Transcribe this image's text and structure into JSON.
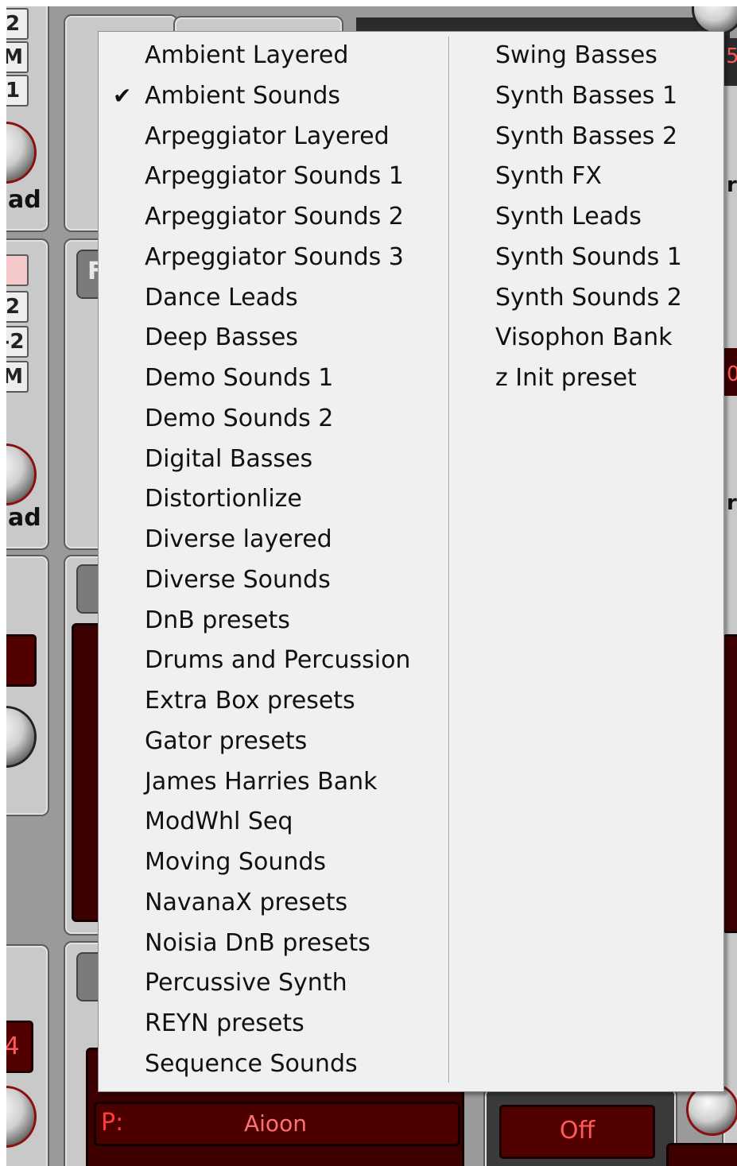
{
  "menu": {
    "left_items": [
      {
        "label": "Ambient Layered",
        "checked": false
      },
      {
        "label": "Ambient Sounds",
        "checked": true
      },
      {
        "label": "Arpeggiator Layered",
        "checked": false
      },
      {
        "label": "Arpeggiator Sounds 1",
        "checked": false
      },
      {
        "label": "Arpeggiator Sounds 2",
        "checked": false
      },
      {
        "label": "Arpeggiator Sounds 3",
        "checked": false
      },
      {
        "label": "Dance Leads",
        "checked": false
      },
      {
        "label": "Deep Basses",
        "checked": false
      },
      {
        "label": "Demo Sounds 1",
        "checked": false
      },
      {
        "label": "Demo Sounds 2",
        "checked": false
      },
      {
        "label": "Digital Basses",
        "checked": false
      },
      {
        "label": "Distortionlize",
        "checked": false
      },
      {
        "label": "Diverse layered",
        "checked": false
      },
      {
        "label": "Diverse Sounds",
        "checked": false
      },
      {
        "label": "DnB presets",
        "checked": false
      },
      {
        "label": "Drums and Percussion",
        "checked": false
      },
      {
        "label": "Extra Box presets",
        "checked": false
      },
      {
        "label": "Gator presets",
        "checked": false
      },
      {
        "label": "James Harries Bank",
        "checked": false
      },
      {
        "label": "ModWhl Seq",
        "checked": false
      },
      {
        "label": "Moving Sounds",
        "checked": false
      },
      {
        "label": "NavanaX presets",
        "checked": false
      },
      {
        "label": "Noisia DnB presets",
        "checked": false
      },
      {
        "label": "Percussive Synth",
        "checked": false
      },
      {
        "label": "REYN presets",
        "checked": false
      },
      {
        "label": "Sequence Sounds",
        "checked": false
      }
    ],
    "right_items": [
      {
        "label": "Swing Basses"
      },
      {
        "label": "Synth Basses 1"
      },
      {
        "label": "Synth Basses 2"
      },
      {
        "label": "Synth FX"
      },
      {
        "label": "Synth Leads"
      },
      {
        "label": "Synth Sounds 1"
      },
      {
        "label": "Synth Sounds 2"
      },
      {
        "label": "Visophon Bank"
      },
      {
        "label": "z Init preset"
      }
    ],
    "check_glyph": "✔"
  },
  "background": {
    "btn_top_2": "2",
    "btn_top_m1": "M",
    "btn_top_1": "1",
    "label_ad_1": "ad",
    "btn_mid_2": "2",
    "btn_mid_m2": "-2",
    "btn_mid_m": "M",
    "label_ad_2": "ad",
    "tab_f": "F",
    "btn_bottom_4": "4",
    "patch_prefix": "P:",
    "patch_name": "Aioon",
    "off_button": "Off",
    "edge_5": "5",
    "edge_r1": "r",
    "edge_r2": "r",
    "edge_0": "0"
  },
  "colors": {
    "menu_bg": "#f0f0f0",
    "lcd_red": "#ff5a5a",
    "panel_grey": "#c9c9c9"
  }
}
